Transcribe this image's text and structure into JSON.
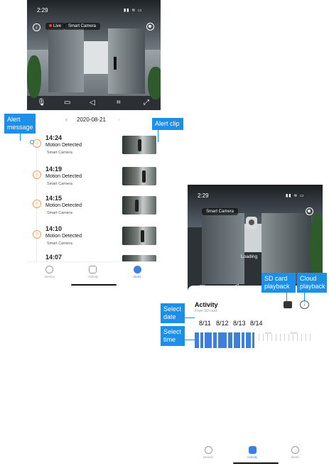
{
  "phone1": {
    "status_time": "2:29",
    "live_label": "Live",
    "camera_name": "Smart Camera",
    "date": "2020-08-21",
    "alerts": [
      {
        "time": "14:24",
        "event": "Motion Detected",
        "camera": "Smart Camera"
      },
      {
        "time": "14:19",
        "event": "Motion Detected",
        "camera": "Smart Camera"
      },
      {
        "time": "14:15",
        "event": "Motion Detected",
        "camera": "Smart Camera"
      },
      {
        "time": "14:10",
        "event": "Motion Detected",
        "camera": "Smart Camera"
      },
      {
        "time": "14:07",
        "event": "",
        "camera": ""
      }
    ],
    "tabs": [
      "Device",
      "Activity",
      "Alerts"
    ],
    "active_tab": "Alerts"
  },
  "phone2": {
    "status_time": "2:29",
    "camera_name": "Smart Camera",
    "loading_text": "Loading",
    "activity_title": "Activity",
    "activity_source": "From SD card",
    "dates": [
      "8/11",
      "8/12",
      "8/13",
      "8/14"
    ],
    "time_ticks": [
      "15:00",
      "16:00"
    ],
    "tabs": [
      "Device",
      "Activity",
      "Alerts"
    ],
    "active_tab": "Activity"
  },
  "callouts": {
    "alert_message": "Alert message",
    "alert_clip": "Alert clip",
    "select_date": "Select date",
    "select_time": "Select time",
    "sd_card_playback": "SD card playback",
    "cloud_playback": "Cloud playback"
  },
  "colors": {
    "callout": "#1d8fe6",
    "accent_blue": "#3c7fe0",
    "alert_orange": "#f0a050"
  },
  "icons": [
    "back-icon",
    "gear-icon",
    "microphone-icon",
    "record-icon",
    "mute-icon",
    "crop-icon",
    "fullscreen-icon",
    "person-motion-icon",
    "device-icon",
    "activity-icon",
    "alerts-icon",
    "sd-card-icon",
    "cloud-download-icon",
    "camera-icon"
  ]
}
